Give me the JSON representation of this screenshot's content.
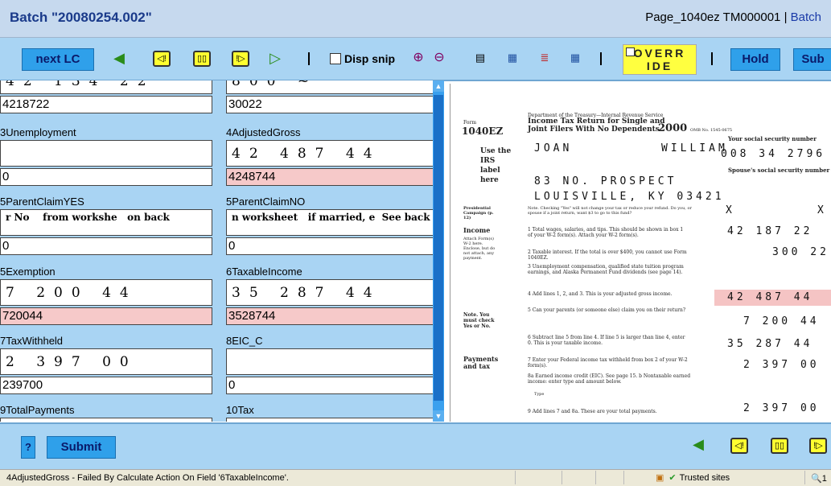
{
  "header": {
    "title": "Batch \"20080254.002\"",
    "page": "Page_1040ez TM000001",
    "sep": "|",
    "batch_link": "Batch"
  },
  "toolbar": {
    "next_lc": "next LC",
    "disp_snip": "Disp snip",
    "override": "OVERR IDE",
    "hold": "Hold",
    "submit_partial": "Sub"
  },
  "fields": [
    {
      "label": "",
      "snip": "42 134 22",
      "value": "4218722",
      "error": false
    },
    {
      "label": "",
      "snip": "800 ~",
      "value": "30022",
      "error": false
    },
    {
      "label": "3Unemployment",
      "snip": "",
      "value": "0",
      "error": false
    },
    {
      "label": "4AdjustedGross",
      "snip": "42 487 44",
      "value": "4248744",
      "error": true
    },
    {
      "label": "5ParentClaimYES",
      "snip": "r No    from workshe   on back",
      "value": "0",
      "error": false
    },
    {
      "label": "5ParentClaimNO",
      "snip": "n worksheet   if married, e  See back for e",
      "value": "0",
      "error": false
    },
    {
      "label": "5Exemption",
      "snip": "7 200 44",
      "value": "720044",
      "error": true
    },
    {
      "label": "6TaxableIncome",
      "snip": "35 287 44",
      "value": "3528744",
      "error": true
    },
    {
      "label": "7TaxWithheld",
      "snip": "2 397 00",
      "value": "239700",
      "error": false
    },
    {
      "label": "8EIC_C",
      "snip": "",
      "value": "0",
      "error": false
    },
    {
      "label": "9TotalPayments",
      "snip": "",
      "value": "",
      "error": false
    },
    {
      "label": "10Tax",
      "snip": "",
      "value": "",
      "error": false
    }
  ],
  "document": {
    "dept": "Department of the Treasury—Internal Revenue Service",
    "form": "Form",
    "form_id": "1040EZ",
    "title1": "Income Tax Return for Single and",
    "title2": "Joint Filers With No Dependents",
    "year": "2000",
    "omb": "OMB No. 1545-0675",
    "use_label": "Use the IRS label here",
    "ssn_heading": "Your social security number",
    "spouse_ssn": "Spouse's social security number",
    "first_name": "JOAN",
    "last_name": "WILLIAM",
    "address": "83 NO. PROSPECT",
    "city": "LOUISVILLE, KY 03421",
    "ssn": "008 34 2796",
    "presidential": "Presidential Campaign (p. 12)",
    "pres_note": "Note. Checking \"Yes\" will not change your tax or reduce your refund. Do you, or spouse if a joint return, want $3 to go to this fund?",
    "income": "Income",
    "attach": "Attach Form(s) W-2 here. Enclose, but do not attach, any payment.",
    "line1": "1  Total wages, salaries, and tips. This should be shown in box 1 of your W-2 form(s). Attach your W-2 form(s).",
    "line2": "2  Taxable interest. If the total is over $400, you cannot use Form 1040EZ.",
    "line3": "3  Unemployment compensation, qualified state tuition program earnings, and Alaska Permanent Fund dividends (see page 14).",
    "line4": "4  Add lines 1, 2, and 3. This is your adjusted gross income.",
    "line5": "5  Can your parents (or someone else) claim you on their return?",
    "note_check": "Note. You must check Yes or No.",
    "line6": "6  Subtract line 5 from line 4. If line 5 is larger than line 4, enter 0. This is your taxable income.",
    "payments": "Payments and tax",
    "line7": "7  Enter your Federal income tax withheld from box 2 of your W-2 form(s).",
    "line8": "8a Earned income credit (EIC). See page 15.  b Nontaxable earned income: enter type and amount below.",
    "type": "Type",
    "line9": "9  Add lines 7 and 8a. These are your total payments.",
    "amt_x": "X",
    "amt1": "42 187 22",
    "amt2": "300 22",
    "amt4": "42 487 44",
    "amt5": "7 200 44",
    "amt6": "35 287 44",
    "amt7": "2 397 00",
    "amt9": "2 397 00"
  },
  "bottom": {
    "help": "?",
    "submit": "Submit"
  },
  "status": {
    "message": "4AdjustedGross - Failed By Calculate Action On Field '6TaxableIncome'.",
    "trusted": "Trusted sites",
    "zoom": "1"
  },
  "colors": {
    "panel": "#a9d4f3",
    "button": "#2fa0ea",
    "error": "#f6c9c9",
    "override": "#ffff40"
  }
}
